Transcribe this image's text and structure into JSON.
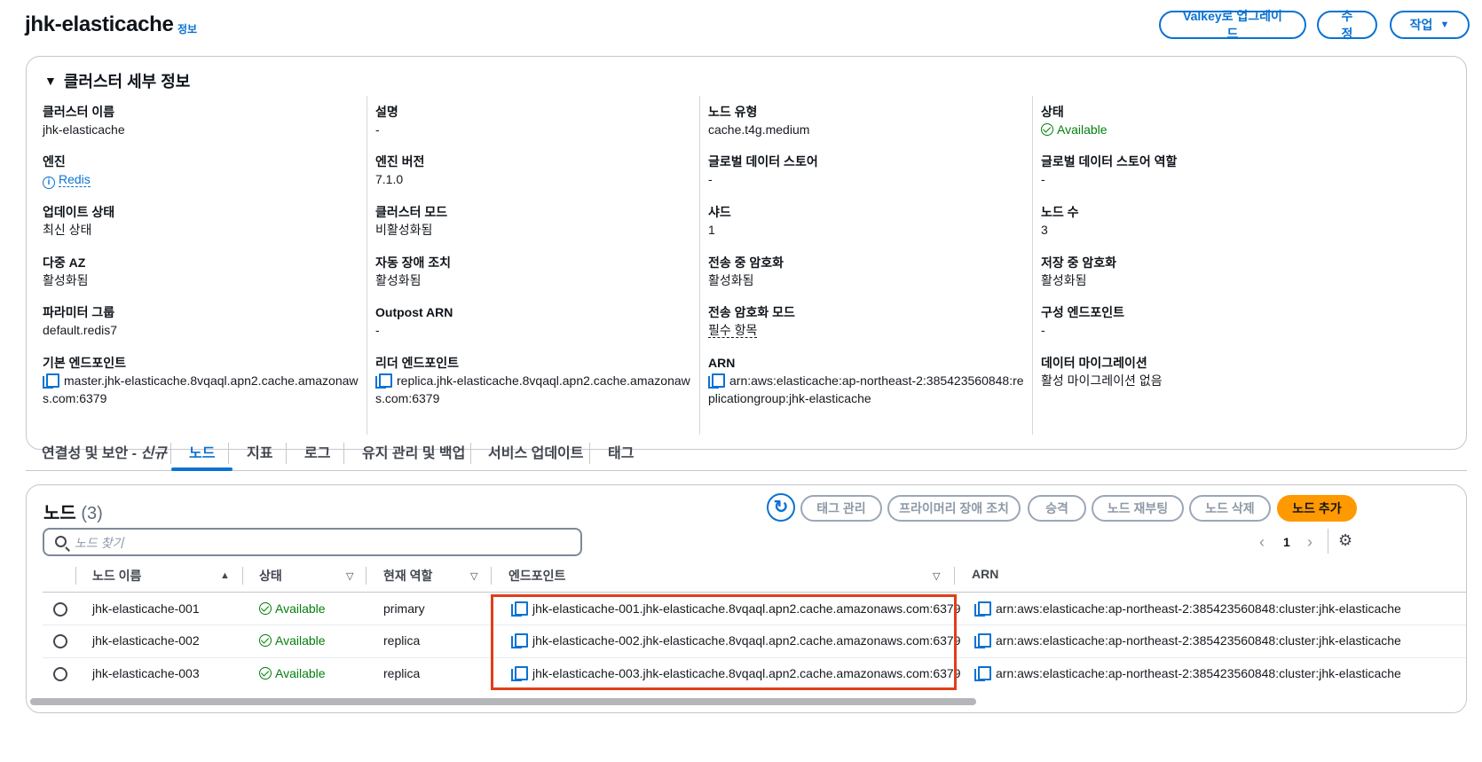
{
  "header": {
    "title": "jhk-elasticache",
    "info_label": "정보",
    "upgrade_button": "Valkey로 업그레이드",
    "edit_button": "수정",
    "actions_button": "작업"
  },
  "details": {
    "panel_title": "클러스터 세부 정보",
    "columns": [
      [
        {
          "key": "클러스터 이름",
          "value": "jhk-elasticache"
        },
        {
          "key": "엔진",
          "value": "Redis"
        },
        {
          "key": "업데이트 상태",
          "value": "최신 상태"
        },
        {
          "key": "다중 AZ",
          "value": "활성화됨"
        },
        {
          "key": "파라미터 그룹",
          "value": "default.redis7"
        },
        {
          "key": "기본 엔드포인트",
          "value": "master.jhk-elasticache.8vqaql.apn2.cache.amazonaws.com:6379"
        }
      ],
      [
        {
          "key": "설명",
          "value": "-"
        },
        {
          "key": "엔진 버전",
          "value": "7.1.0"
        },
        {
          "key": "클러스터 모드",
          "value": "비활성화됨"
        },
        {
          "key": "자동 장애 조치",
          "value": "활성화됨"
        },
        {
          "key": "Outpost ARN",
          "value": "-"
        },
        {
          "key": "리더 엔드포인트",
          "value": "replica.jhk-elasticache.8vqaql.apn2.cache.amazonaws.com:6379"
        }
      ],
      [
        {
          "key": "노드 유형",
          "value": "cache.t4g.medium"
        },
        {
          "key": "글로벌 데이터 스토어",
          "value": "-"
        },
        {
          "key": "샤드",
          "value": "1"
        },
        {
          "key": "전송 중 암호화",
          "value": "활성화됨"
        },
        {
          "key": "전송 암호화 모드",
          "value": "필수 항목"
        },
        {
          "key": "ARN",
          "value": "arn:aws:elasticache:ap-northeast-2:385423560848:replicationgroup:jhk-elasticache"
        }
      ],
      [
        {
          "key": "상태",
          "value": "Available"
        },
        {
          "key": "글로벌 데이터 스토어 역할",
          "value": "-"
        },
        {
          "key": "노드 수",
          "value": "3"
        },
        {
          "key": "저장 중 암호화",
          "value": "활성화됨"
        },
        {
          "key": "구성 엔드포인트",
          "value": "-"
        },
        {
          "key": "데이터 마이그레이션",
          "value": "활성 마이그레이션 없음"
        }
      ]
    ]
  },
  "tabs": [
    {
      "label": "연결성 및 보안 - ",
      "tag": "신규"
    },
    {
      "label": "노드"
    },
    {
      "label": "지표"
    },
    {
      "label": "로그"
    },
    {
      "label": "유지 관리 및 백업"
    },
    {
      "label": "서비스 업데이트"
    },
    {
      "label": "태그"
    }
  ],
  "nodes": {
    "title": "노드",
    "count": "(3)",
    "buttons": {
      "manage_tags": "태그 관리",
      "failover": "프라이머리 장애 조치",
      "promote": "승격",
      "reboot": "노드 재부팅",
      "delete": "노드 삭제",
      "add": "노드 추가"
    },
    "search_placeholder": "노드 찾기",
    "page": "1",
    "columns": {
      "name": "노드 이름",
      "status": "상태",
      "role": "현재 역할",
      "endpoint": "엔드포인트",
      "arn": "ARN"
    },
    "rows": [
      {
        "name": "jhk-elasticache-001",
        "status": "Available",
        "role": "primary",
        "endpoint": "jhk-elasticache-001.jhk-elasticache.8vqaql.apn2.cache.amazonaws.com:6379",
        "arn": "arn:aws:elasticache:ap-northeast-2:385423560848:cluster:jhk-elasticache"
      },
      {
        "name": "jhk-elasticache-002",
        "status": "Available",
        "role": "replica",
        "endpoint": "jhk-elasticache-002.jhk-elasticache.8vqaql.apn2.cache.amazonaws.com:6379",
        "arn": "arn:aws:elasticache:ap-northeast-2:385423560848:cluster:jhk-elasticache"
      },
      {
        "name": "jhk-elasticache-003",
        "status": "Available",
        "role": "replica",
        "endpoint": "jhk-elasticache-003.jhk-elasticache.8vqaql.apn2.cache.amazonaws.com:6379",
        "arn": "arn:aws:elasticache:ap-northeast-2:385423560848:cluster:jhk-elasticache"
      }
    ]
  },
  "colors": {
    "link": "#0972d3",
    "success": "#037f0c",
    "primary_button": "#ff9900",
    "highlight": "#e03e1a"
  }
}
